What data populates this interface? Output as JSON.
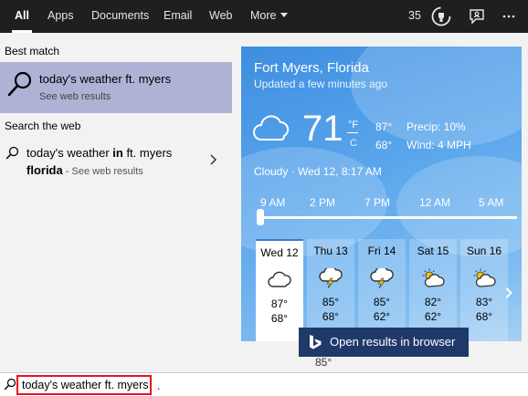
{
  "tabs": [
    {
      "label": "All",
      "active": true
    },
    {
      "label": "Apps"
    },
    {
      "label": "Documents"
    },
    {
      "label": "Email"
    },
    {
      "label": "Web"
    },
    {
      "label": "More"
    }
  ],
  "topbar": {
    "points": "35",
    "icons": [
      "rewards-badge-icon",
      "feedback-icon",
      "more-options-icon"
    ]
  },
  "left": {
    "best_match_label": "Best match",
    "best_match": {
      "title": "today's weather ft. myers",
      "subtitle": "See web results"
    },
    "search_web_label": "Search the web",
    "web_result": {
      "prefix": "today's weather ",
      "bold1": "in",
      "middle": " ft. myers",
      "bold2": "florida",
      "suffix": " - See web results"
    }
  },
  "weather": {
    "city": "Fort Myers, Florida",
    "updated": "Updated a few minutes ago",
    "temp": "71",
    "unit_f": "°F",
    "unit_c": "C",
    "hi": "87°",
    "lo": "68°",
    "precip": "Precip: 10%",
    "wind": "Wind: 4 MPH",
    "condition": "Cloudy · Wed 12, 8:17 AM",
    "hours": [
      "9 AM",
      "2 PM",
      "7 PM",
      "12 AM",
      "5 AM"
    ],
    "slider_position": 0,
    "days": [
      {
        "name": "Wed 12",
        "icon": "cloudy",
        "hi": "87°",
        "lo": "68°",
        "active": true
      },
      {
        "name": "Thu 13",
        "icon": "thunderstorm",
        "hi": "85°",
        "lo": "68°"
      },
      {
        "name": "Fri 14",
        "icon": "thunderstorm",
        "hi": "85°",
        "lo": "62°"
      },
      {
        "name": "Sat 15",
        "icon": "partly-sunny",
        "hi": "82°",
        "lo": "62°"
      },
      {
        "name": "Sun 16",
        "icon": "partly-sunny",
        "hi": "83°",
        "lo": "68°"
      }
    ],
    "peek_temp": "85°",
    "open_button": "Open results in browser"
  },
  "searchbar": {
    "value": "today's weather ft. myers",
    "trailing": "."
  },
  "colors": {
    "accent": "#20396b",
    "selection": "#aeb3d6",
    "topbar": "#1f1f1f",
    "highlight_border": "#e81123"
  }
}
